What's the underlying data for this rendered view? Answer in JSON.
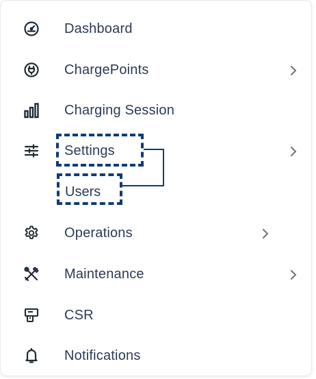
{
  "menu": {
    "items": [
      {
        "label": "Dashboard",
        "icon": "speedometer-icon",
        "has_children": false
      },
      {
        "label": "ChargePoints",
        "icon": "ev-plug-icon",
        "has_children": true
      },
      {
        "label": "Charging Session",
        "icon": "bar-chart-icon",
        "has_children": false
      },
      {
        "label": "Settings",
        "icon": "sliders-icon",
        "has_children": true
      },
      {
        "label": "Operations",
        "icon": "gear-icon",
        "has_children": true
      },
      {
        "label": "Maintenance",
        "icon": "tools-icon",
        "has_children": true
      },
      {
        "label": "CSR",
        "icon": "id-card-icon",
        "has_children": false
      },
      {
        "label": "Notifications",
        "icon": "bell-icon",
        "has_children": false
      }
    ],
    "submenu": {
      "parent": "Settings",
      "items": [
        {
          "label": "Users"
        }
      ]
    }
  },
  "colors": {
    "text": "#2b3a55",
    "icon": "#1f2937",
    "highlight": "#0d3b78",
    "chevron": "#6b7280"
  }
}
